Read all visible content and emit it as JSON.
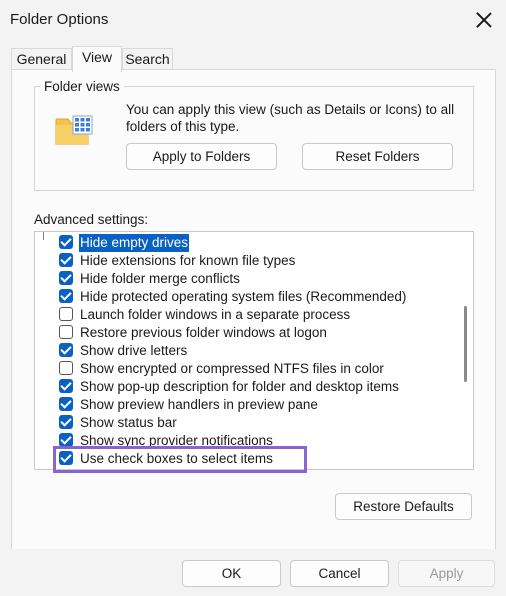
{
  "window": {
    "title": "Folder Options"
  },
  "tabs": [
    {
      "label": "General"
    },
    {
      "label": "View"
    },
    {
      "label": "Search"
    }
  ],
  "folder_views": {
    "label": "Folder views",
    "description": "You can apply this view (such as Details or Icons) to all folders of this type.",
    "apply_button": "Apply to Folders",
    "reset_button": "Reset Folders",
    "icon": "folder-grid-icon"
  },
  "advanced": {
    "label": "Advanced settings:",
    "items": [
      {
        "label": "Hide empty drives",
        "checked": true,
        "selected": true
      },
      {
        "label": "Hide extensions for known file types",
        "checked": true
      },
      {
        "label": "Hide folder merge conflicts",
        "checked": true
      },
      {
        "label": "Hide protected operating system files (Recommended)",
        "checked": true
      },
      {
        "label": "Launch folder windows in a separate process",
        "checked": false
      },
      {
        "label": "Restore previous folder windows at logon",
        "checked": false
      },
      {
        "label": "Show drive letters",
        "checked": true
      },
      {
        "label": "Show encrypted or compressed NTFS files in color",
        "checked": false
      },
      {
        "label": "Show pop-up description for folder and desktop items",
        "checked": true
      },
      {
        "label": "Show preview handlers in preview pane",
        "checked": true
      },
      {
        "label": "Show status bar",
        "checked": true
      },
      {
        "label": "Show sync provider notifications",
        "checked": true
      },
      {
        "label": "Use check boxes to select items",
        "checked": true,
        "highlighted": true
      }
    ],
    "restore_defaults": "Restore Defaults"
  },
  "footer": {
    "ok": "OK",
    "cancel": "Cancel",
    "apply": "Apply"
  },
  "colors": {
    "accent": "#0a61c4",
    "highlight_outline": "#8a63d2"
  }
}
